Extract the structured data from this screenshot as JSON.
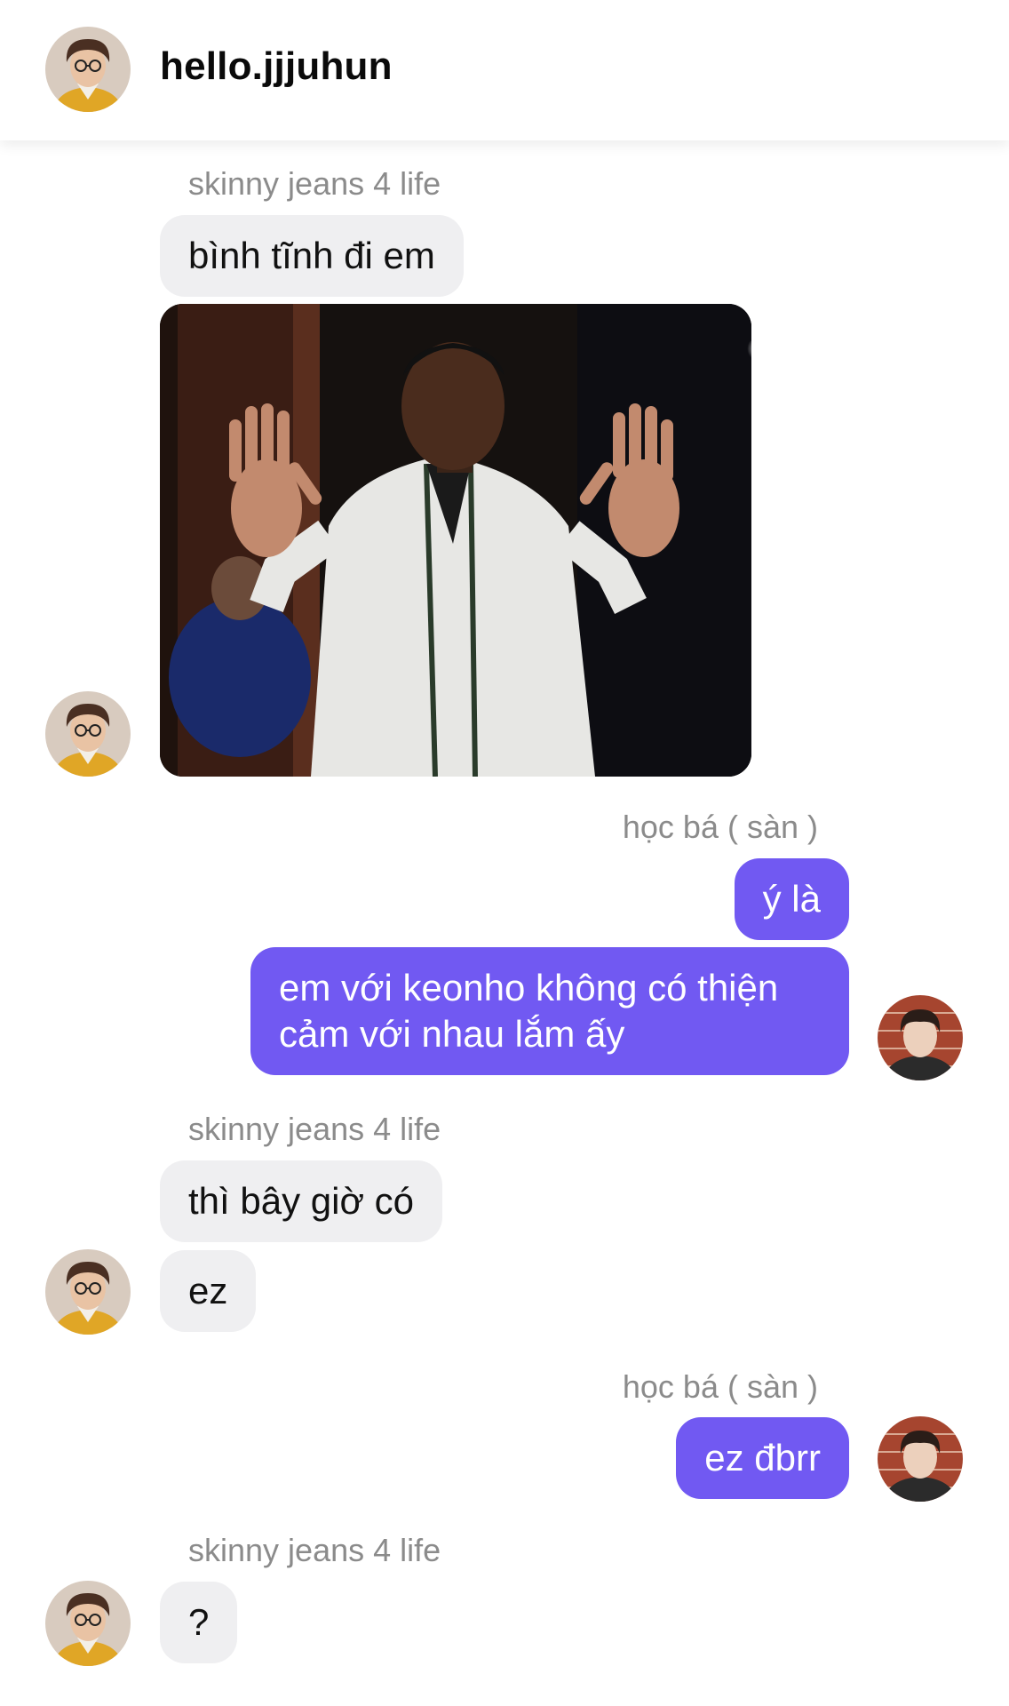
{
  "header": {
    "title": "hello.jjjuhun",
    "avatar_icon": "profile-avatar-icon"
  },
  "colors": {
    "incoming_bubble": "#efeff1",
    "outgoing_bubble": "#7159f2",
    "sender_label": "#8b8b8b"
  },
  "messages": [
    {
      "sender": "skinny jeans 4 life",
      "text": "bình tĩnh đi em"
    },
    {
      "image": "photo of a man in a white shirt raising both open palms"
    },
    {
      "sender": "học bá ( sàn )",
      "text": "ý là"
    },
    {
      "text": "em với keonho không có thiện cảm với nhau lắm ấy"
    },
    {
      "sender": "skinny jeans 4 life",
      "text": "thì bây giờ có"
    },
    {
      "text": "ez"
    },
    {
      "sender": "học bá ( sàn )",
      "text": "ez đbrr"
    },
    {
      "sender": "skinny jeans 4 life",
      "text": "?"
    }
  ]
}
